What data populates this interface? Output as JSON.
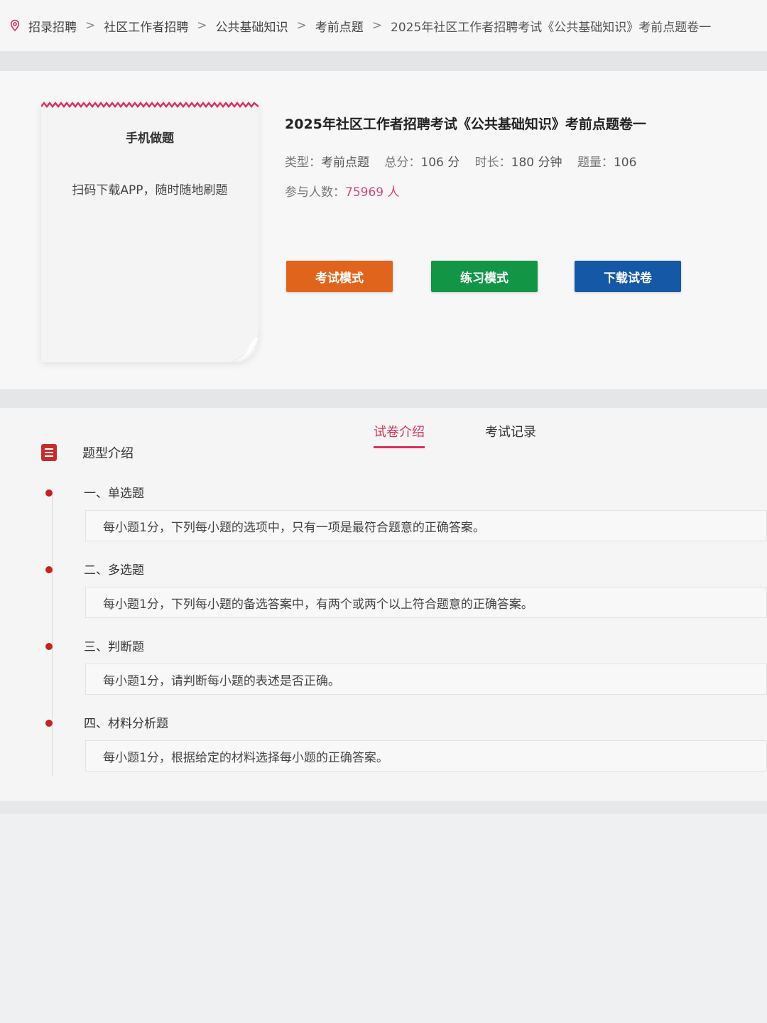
{
  "breadcrumb": {
    "items": [
      "招录招聘",
      "社区工作者招聘",
      "公共基础知识",
      "考前点题"
    ],
    "current": "2025年社区工作者招聘考试《公共基础知识》考前点题卷一",
    "separator": ">"
  },
  "phone_card": {
    "title": "手机做题",
    "description": "扫码下载APP，随时随地刷题"
  },
  "exam": {
    "title": "2025年社区工作者招聘考试《公共基础知识》考前点题卷一",
    "type_label": "类型：",
    "type_value": "考前点题",
    "score_label": "总分：",
    "score_value": "106 分",
    "duration_label": "时长：",
    "duration_value": "180 分钟",
    "count_label": "题量：",
    "count_value": "106",
    "participants_label": "参与人数：",
    "participants_value": "75969 人"
  },
  "buttons": {
    "exam_mode": "考试模式",
    "practice_mode": "练习模式",
    "download": "下载试卷"
  },
  "tabs": {
    "intro": "试卷介绍",
    "record": "考试记录"
  },
  "section": {
    "title": "题型介绍",
    "types": [
      {
        "name": "一、单选题",
        "desc": "每小题1分，下列每小题的选项中，只有一项是最符合题意的正确答案。"
      },
      {
        "name": "二、多选题",
        "desc": "每小题1分，下列每小题的备选答案中，有两个或两个以上符合题意的正确答案。"
      },
      {
        "name": "三、判断题",
        "desc": "每小题1分，请判断每小题的表述是否正确。"
      },
      {
        "name": "四、材料分析题",
        "desc": "每小题1分，根据给定的材料选择每小题的正确答案。"
      }
    ]
  },
  "colors": {
    "accent": "#d6335a",
    "exam_button": "#e1641d",
    "practice_button": "#129646",
    "download_button": "#1458a6",
    "bullet": "#c62323"
  }
}
